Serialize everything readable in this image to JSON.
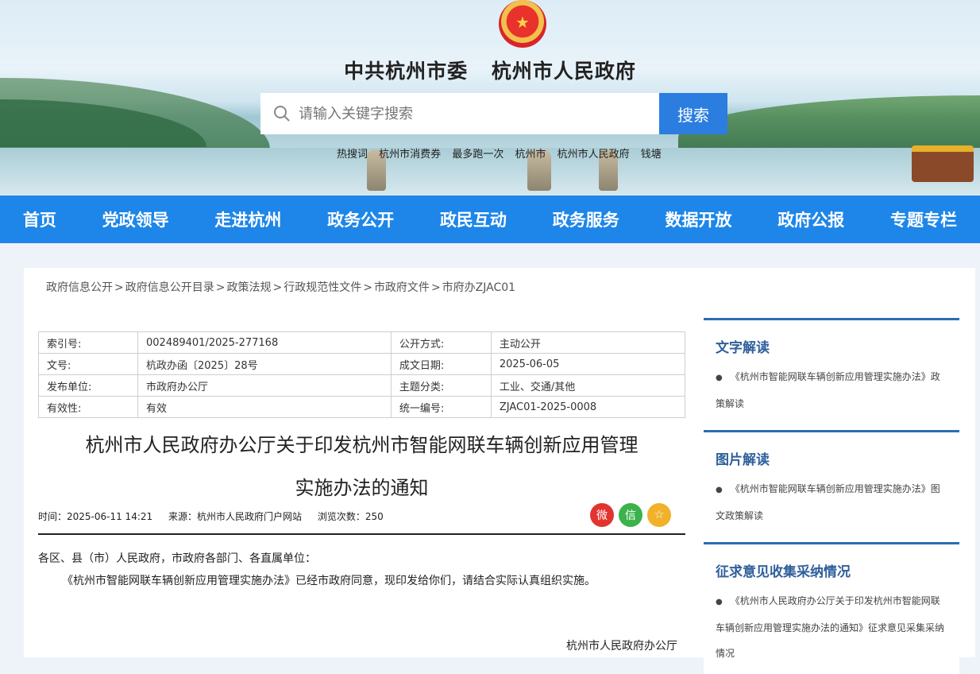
{
  "header": {
    "title_party": "中共杭州市委",
    "title_gov": "杭州市人民政府",
    "search": {
      "placeholder": "请输入关键字搜索",
      "button_label": "搜索"
    },
    "hot_words": [
      "热搜词",
      "杭州市消费券",
      "最多跑一次",
      "杭州市",
      "杭州市人民政府",
      "钱塘"
    ]
  },
  "nav": [
    "首页",
    "党政领导",
    "走进杭州",
    "政务公开",
    "政民互动",
    "政务服务",
    "数据开放",
    "政府公报",
    "专题专栏"
  ],
  "breadcrumb": [
    "政府信息公开",
    "政府信息公开目录",
    "政策法规",
    "行政规范性文件",
    "市政府文件",
    "市府办ZJAC01"
  ],
  "meta": {
    "index_label": "索引号:",
    "index_value": "002489401/2025-277168",
    "public_label": "公开方式:",
    "public_value": "主动公开",
    "docno_label": "文号:",
    "docno_value": "杭政办函〔2025〕28号",
    "date_label": "成文日期:",
    "date_value": "2025-06-05",
    "issuer_label": "发布单位:",
    "issuer_value": "市政府办公厅",
    "topic_label": "主题分类:",
    "topic_value": "工业、交通/其他",
    "validity_label": "有效性:",
    "validity_value": "有效",
    "code_label": "统一编号:",
    "code_value": "ZJAC01-2025-0008"
  },
  "article": {
    "title_line1": "杭州市人民政府办公厅关于印发杭州市智能网联车辆创新应用管理",
    "title_line2": "实施办法的通知",
    "time": "时间：2025-06-11 14:21",
    "source": "来源：杭州市人民政府门户网站",
    "views": "浏览次数：250",
    "p1": "各区、县（市）人民政府，市政府各部门、各直属单位：",
    "p2": "《杭州市智能网联车辆创新应用管理实施办法》已经市政府同意，现印发给你们，请结合实际认真组织实施。",
    "signature": "杭州市人民政府办公厅"
  },
  "sidebar": [
    {
      "title": "文字解读",
      "item": "《杭州市智能网联车辆创新应用管理实施办法》政策解读"
    },
    {
      "title": "图片解读",
      "item": "《杭州市智能网联车辆创新应用管理实施办法》图文政策解读"
    },
    {
      "title": "征求意见收集采纳情况",
      "item": "《杭州市人民政府办公厅关于印发杭州市智能网联车辆创新应用管理实施办法的通知》征求意见采集采纳情况"
    }
  ],
  "colors": {
    "nav_bg": "#1e86e8",
    "search_btn": "#2b7de0",
    "sidebar_title": "#2f5f9b",
    "weibo": "#e2342f",
    "wechat": "#3bb24a",
    "favorite": "#f2b12b"
  },
  "icons": {
    "share": [
      "weibo-icon",
      "wechat-icon",
      "favorite-icon"
    ]
  }
}
